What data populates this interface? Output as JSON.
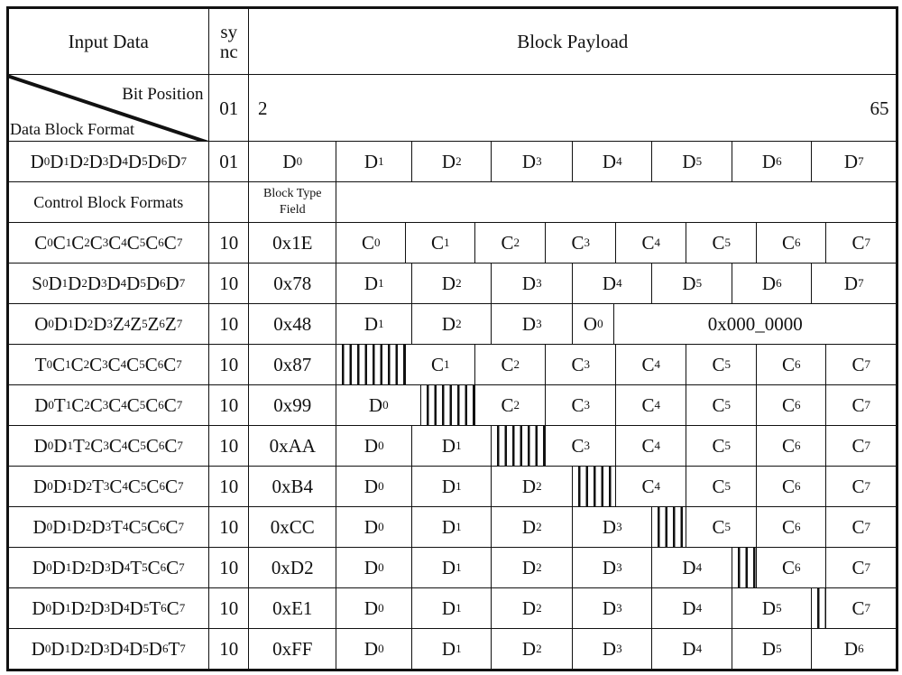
{
  "header": {
    "input_data": "Input Data",
    "sync": "sync",
    "block_payload": "Block Payload"
  },
  "bit_position_row": {
    "bit_position_label": "Bit Position",
    "data_block_format_label": "Data Block Format",
    "sync": "01",
    "start_bit": "2",
    "end_bit": "65"
  },
  "data_row": {
    "format": "D0D1D2D3D4D5D6D7",
    "sync": "01",
    "fields": [
      "D0",
      "D1",
      "D2",
      "D3",
      "D4",
      "D5",
      "D6",
      "D7"
    ]
  },
  "control_header": {
    "label": "Control Block Formats",
    "type_field": "Block Type Field"
  },
  "control_rows": [
    {
      "format": "C0C1C2C3C4C5C6C7",
      "sync": "10",
      "type": "0x1E",
      "fields": [
        {
          "t": "C0"
        },
        {
          "t": "C1"
        },
        {
          "t": "C2"
        },
        {
          "t": "C3"
        },
        {
          "t": "C4"
        },
        {
          "t": "C5"
        },
        {
          "t": "C6"
        },
        {
          "t": "C7"
        }
      ]
    },
    {
      "format": "S0D1D2D3D4D5D6D7",
      "sync": "10",
      "type": "0x78",
      "fields": [
        {
          "t": "D1"
        },
        {
          "t": "D2"
        },
        {
          "t": "D3"
        },
        {
          "t": "D4"
        },
        {
          "t": "D5"
        },
        {
          "t": "D6"
        },
        {
          "t": "D7"
        }
      ]
    },
    {
      "format": "O0D1D2D3Z4Z5Z6Z7",
      "sync": "10",
      "type": "0x48",
      "fields": [
        {
          "t": "D1"
        },
        {
          "t": "D2"
        },
        {
          "t": "D3"
        },
        {
          "t": "O0"
        },
        {
          "t": "0x000_0000"
        }
      ]
    },
    {
      "format": "T0C1C2C3C4C5C6C7",
      "sync": "10",
      "type": "0x87",
      "fields": [
        {
          "hatch": true
        },
        {
          "t": "C1"
        },
        {
          "t": "C2"
        },
        {
          "t": "C3"
        },
        {
          "t": "C4"
        },
        {
          "t": "C5"
        },
        {
          "t": "C6"
        },
        {
          "t": "C7"
        }
      ]
    },
    {
      "format": "D0T1C2C3C4C5C6C7",
      "sync": "10",
      "type": "0x99",
      "fields": [
        {
          "t": "D0"
        },
        {
          "hatch": true
        },
        {
          "t": "C2"
        },
        {
          "t": "C3"
        },
        {
          "t": "C4"
        },
        {
          "t": "C5"
        },
        {
          "t": "C6"
        },
        {
          "t": "C7"
        }
      ]
    },
    {
      "format": "D0D1T2C3C4C5C6C7",
      "sync": "10",
      "type": "0xAA",
      "fields": [
        {
          "t": "D0"
        },
        {
          "t": "D1"
        },
        {
          "hatch": true
        },
        {
          "t": "C3"
        },
        {
          "t": "C4"
        },
        {
          "t": "C5"
        },
        {
          "t": "C6"
        },
        {
          "t": "C7"
        }
      ]
    },
    {
      "format": "D0D1D2T3C4C5C6C7",
      "sync": "10",
      "type": "0xB4",
      "fields": [
        {
          "t": "D0"
        },
        {
          "t": "D1"
        },
        {
          "t": "D2"
        },
        {
          "hatch": true
        },
        {
          "t": "C4"
        },
        {
          "t": "C5"
        },
        {
          "t": "C6"
        },
        {
          "t": "C7"
        }
      ]
    },
    {
      "format": "D0D1D2D3T4C5C6C7",
      "sync": "10",
      "type": "0xCC",
      "fields": [
        {
          "t": "D0"
        },
        {
          "t": "D1"
        },
        {
          "t": "D2"
        },
        {
          "t": "D3"
        },
        {
          "hatch": true
        },
        {
          "t": "C5"
        },
        {
          "t": "C6"
        },
        {
          "t": "C7"
        }
      ]
    },
    {
      "format": "D0D1D2D3D4T5C6C7",
      "sync": "10",
      "type": "0xD2",
      "fields": [
        {
          "t": "D0"
        },
        {
          "t": "D1"
        },
        {
          "t": "D2"
        },
        {
          "t": "D3"
        },
        {
          "t": "D4"
        },
        {
          "hatch": true
        },
        {
          "t": "C6"
        },
        {
          "t": "C7"
        }
      ]
    },
    {
      "format": "D0D1D2D3D4D5T6C7",
      "sync": "10",
      "type": "0xE1",
      "fields": [
        {
          "t": "D0"
        },
        {
          "t": "D1"
        },
        {
          "t": "D2"
        },
        {
          "t": "D3"
        },
        {
          "t": "D4"
        },
        {
          "t": "D5"
        },
        {
          "hatch": true
        },
        {
          "t": "C7"
        }
      ]
    },
    {
      "format": "D0D1D2D3D4D5D6T7",
      "sync": "10",
      "type": "0xFF",
      "fields": [
        {
          "t": "D0"
        },
        {
          "t": "D1"
        },
        {
          "t": "D2"
        },
        {
          "t": "D3"
        },
        {
          "t": "D4"
        },
        {
          "t": "D5"
        },
        {
          "t": "D6"
        }
      ]
    }
  ]
}
